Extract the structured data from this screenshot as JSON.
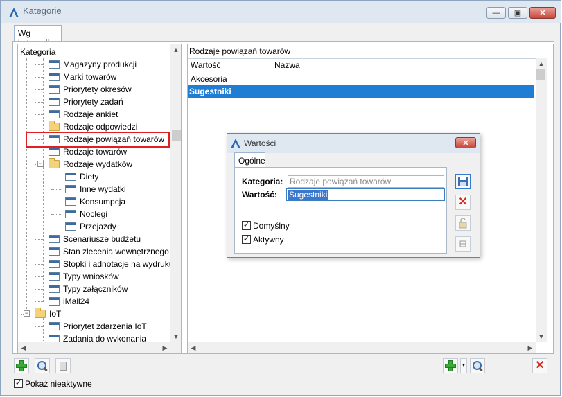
{
  "window": {
    "title": "Kategorie",
    "minimize_glyph": "—",
    "restore_glyph": "▣",
    "close_glyph": "✕"
  },
  "tabs": {
    "category_tab": "Wg kategorii"
  },
  "tree": {
    "header": "Kategoria",
    "items": [
      {
        "label": "Magazyny produkcji",
        "icon": "window-icon"
      },
      {
        "label": "Marki towarów",
        "icon": "window-icon"
      },
      {
        "label": "Priorytety okresów",
        "icon": "window-icon"
      },
      {
        "label": "Priorytety zadań",
        "icon": "window-icon"
      },
      {
        "label": "Rodzaje ankiet",
        "icon": "window-icon"
      },
      {
        "label": "Rodzaje odpowiedzi",
        "icon": "folder-icon"
      },
      {
        "label": "Rodzaje powiązań towarów",
        "icon": "window-icon"
      },
      {
        "label": "Rodzaje towarów",
        "icon": "window-icon"
      },
      {
        "label": "Rodzaje wydatków",
        "icon": "folder-icon"
      },
      {
        "label": "Diety",
        "icon": "window-icon"
      },
      {
        "label": "Inne wydatki",
        "icon": "window-icon"
      },
      {
        "label": "Konsumpcja",
        "icon": "window-icon"
      },
      {
        "label": "Noclegi",
        "icon": "window-icon"
      },
      {
        "label": "Przejazdy",
        "icon": "window-icon"
      },
      {
        "label": "Scenariusze budżetu",
        "icon": "window-icon"
      },
      {
        "label": "Stan zlecenia wewnętrznego",
        "icon": "window-icon"
      },
      {
        "label": "Stopki i adnotacje na wydruku",
        "icon": "window-icon"
      },
      {
        "label": "Typy wniosków",
        "icon": "window-icon"
      },
      {
        "label": "Typy załączników",
        "icon": "window-icon"
      },
      {
        "label": "iMall24",
        "icon": "window-icon"
      },
      {
        "label": "IoT",
        "icon": "folder-icon"
      },
      {
        "label": "Priorytet zdarzenia IoT",
        "icon": "window-icon"
      },
      {
        "label": "Zadania do wykonania",
        "icon": "window-icon"
      }
    ],
    "expand_minus": "−"
  },
  "grid": {
    "caption": "Rodzaje powiązań towarów",
    "columns": [
      "Wartość",
      "Nazwa"
    ],
    "rows": [
      {
        "value": "Akcesoria",
        "name": ""
      },
      {
        "value": "Sugestniki",
        "name": "",
        "selected": true
      }
    ]
  },
  "bottom": {
    "show_inactive_label": "Pokaż nieaktywne",
    "show_inactive_checked": true
  },
  "dialog": {
    "title": "Wartości",
    "close_glyph": "✕",
    "tab": "Ogólne",
    "category_label": "Kategoria:",
    "category_value": "Rodzaje powiązań towarów",
    "value_label": "Wartość:",
    "value_value": "Sugestniki",
    "default_label": "Domyślny",
    "active_label": "Aktywny",
    "check_glyph": "✓"
  },
  "colors": {
    "accent": "#1f7ed4",
    "highlight": "#e02020"
  }
}
